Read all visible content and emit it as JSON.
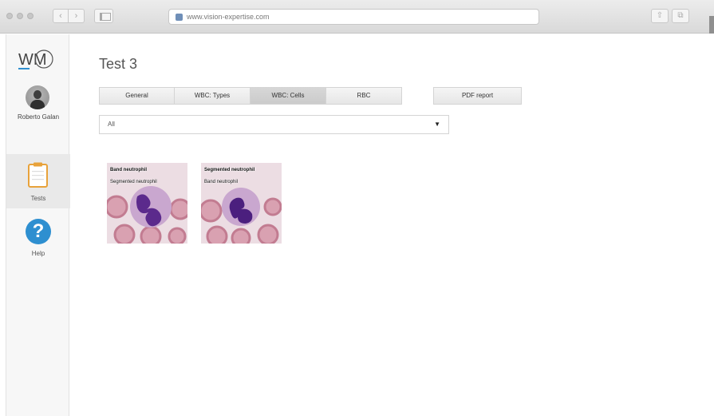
{
  "browser": {
    "url": "www.vision-expertise.com"
  },
  "sidebar": {
    "logo_text": "WM",
    "user_name": "Roberto Galan",
    "items": [
      {
        "label": "Tests",
        "icon": "clipboard-icon"
      },
      {
        "label": "Help",
        "icon": "help-icon"
      }
    ]
  },
  "main": {
    "title": "Test 3",
    "tabs": [
      {
        "label": "General"
      },
      {
        "label": "WBC: Types"
      },
      {
        "label": "WBC: Cells",
        "active": true
      },
      {
        "label": "RBC"
      }
    ],
    "pdf_button": "PDF report",
    "filter": {
      "value": "All",
      "arrow": "▼"
    },
    "cells": [
      {
        "caption_top": "Band neutrophil",
        "caption_bottom": "Segmented neutrophil"
      },
      {
        "caption_top": "Segmented neutrophil",
        "caption_bottom": "Band neutrophil"
      }
    ]
  },
  "colors": {
    "accent_help": "#2e8fd0",
    "logo_blue": "#2e8fd0",
    "cell_nucleus": "#5b2a8c",
    "rbc": "#c98a9c"
  }
}
